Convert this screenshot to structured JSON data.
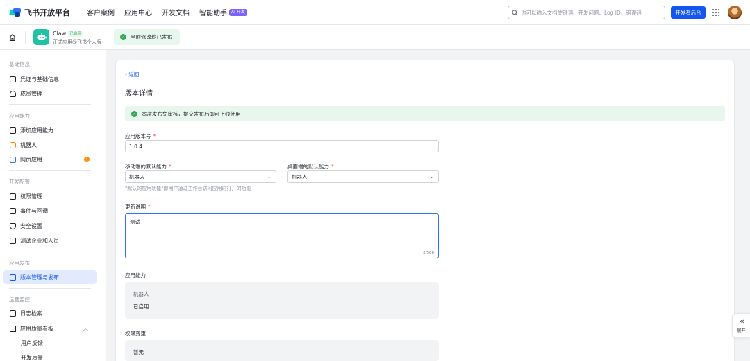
{
  "topnav": {
    "brand": "飞书开放平台",
    "links": [
      {
        "label": "客户案例"
      },
      {
        "label": "应用中心"
      },
      {
        "label": "开发文档"
      },
      {
        "label": "智能助手",
        "badge": "AI 开发"
      }
    ],
    "search_placeholder": "你可以输入文档关键词、开发问题、Log ID、错误码",
    "dev_console_label": "开发者后台"
  },
  "subheader": {
    "app_name": "Claw",
    "app_status": "已启用",
    "app_desc": "正式应用@飞书个人版",
    "toast": "当前修改均已发布"
  },
  "sidebar": {
    "sections": [
      {
        "title": "基础信息",
        "items": [
          {
            "label": "凭证与基础信息",
            "icon": "credential-icon"
          },
          {
            "label": "成员管理",
            "icon": "member-icon"
          }
        ]
      },
      {
        "title": "应用能力",
        "items": [
          {
            "label": "添加应用能力",
            "icon": "add-capability-icon"
          },
          {
            "label": "机器人",
            "icon": "robot-icon"
          },
          {
            "label": "网页应用",
            "icon": "web-app-icon",
            "alert": "!"
          }
        ]
      },
      {
        "title": "开发配置",
        "items": [
          {
            "label": "权限管理",
            "icon": "permission-icon"
          },
          {
            "label": "事件与回调",
            "icon": "event-icon"
          },
          {
            "label": "安全设置",
            "icon": "security-icon"
          },
          {
            "label": "测试企业和人员",
            "icon": "test-icon"
          }
        ]
      },
      {
        "title": "应用发布",
        "items": [
          {
            "label": "版本管理与发布",
            "icon": "version-icon",
            "active": true
          }
        ]
      },
      {
        "title": "运营监控",
        "items": [
          {
            "label": "日志检索",
            "icon": "log-icon"
          },
          {
            "label": "应用质量看板",
            "icon": "quality-icon"
          },
          {
            "label": "用户反馈"
          },
          {
            "label": "开发质量"
          }
        ]
      }
    ]
  },
  "main": {
    "back": "返回",
    "title": "版本详情",
    "notice": "本次发布免审核，提交发布后即可上线使用",
    "version_label": "应用版本号",
    "version_value": "1.0.4",
    "mobile_label": "移动端的默认能力",
    "mobile_value": "机器人",
    "desktop_label": "桌面端的默认能力",
    "desktop_value": "机器人",
    "hint": "\"默认的应用功能\"即用户通过工作台访问应用时打开的功能",
    "update_label": "更新说明",
    "update_value": "测试",
    "counter": "2/500",
    "capability_label": "应用能力",
    "capability_name": "机器人",
    "capability_status": "已启用",
    "permission_label": "权限变更",
    "permission_value": "暂无",
    "required_mark": "*"
  },
  "expand_label": "展开",
  "colors": {
    "primary": "#1456f0",
    "success": "#34a853",
    "notice_bg": "#e8f7ee",
    "app_icon": "#21c1a6"
  }
}
